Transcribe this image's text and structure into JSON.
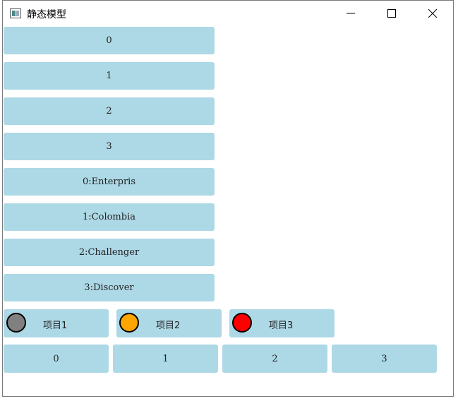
{
  "window": {
    "title": "静态模型",
    "icons": {
      "app": "app-window-icon",
      "minimize": "minimize-icon",
      "maximize": "maximize-icon",
      "close": "close-icon"
    }
  },
  "column_items": [
    "0",
    "1",
    "2",
    "3",
    "0:Enterpris",
    "1:Colombia",
    "2:Challenger",
    "3:Discover"
  ],
  "status_items": [
    {
      "label": "项目1",
      "color": "#808080"
    },
    {
      "label": "项目2",
      "color": "#FFA500"
    },
    {
      "label": "项目3",
      "color": "#FF0000"
    }
  ],
  "row_items": [
    "0",
    "1",
    "2",
    "3"
  ],
  "colors": {
    "tile": "#ADD8E6"
  }
}
